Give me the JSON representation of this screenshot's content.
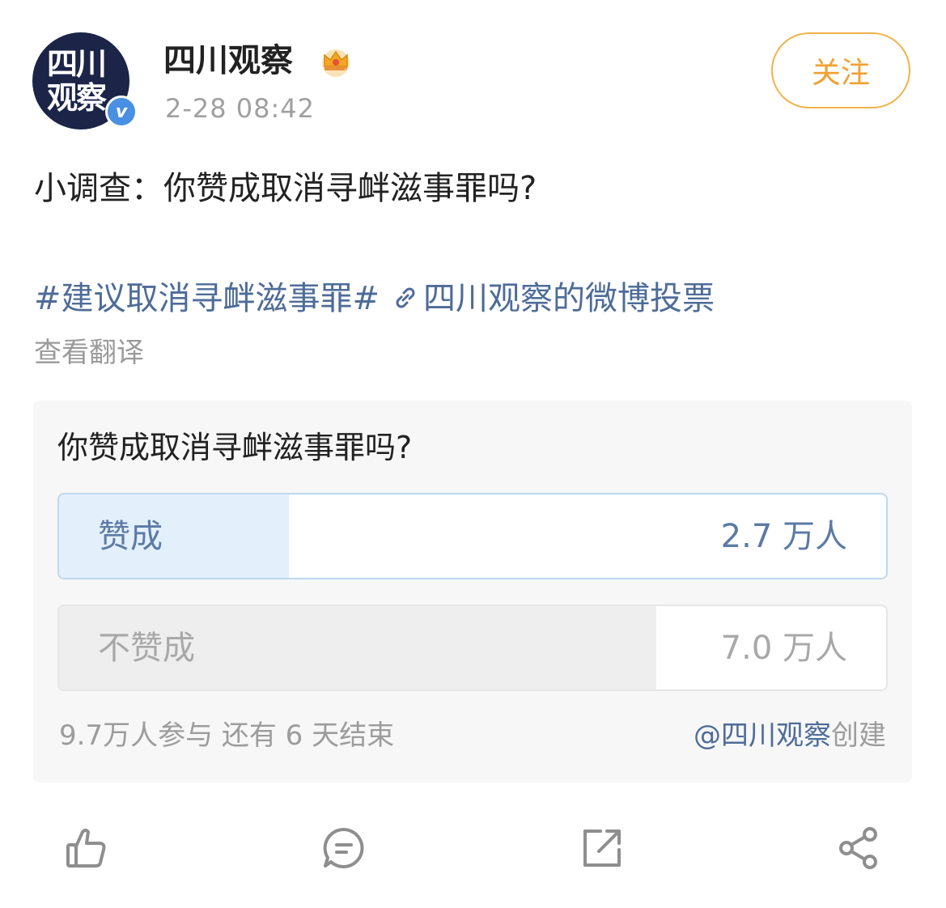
{
  "account": {
    "avatar_text": "四川\n观察",
    "verified_mark": "v",
    "name": "四川观察",
    "badge_icon": "crown-icon",
    "time": "2-28 08:42",
    "follow_label": "关注"
  },
  "post": {
    "text": "小调查：你赞成取消寻衅滋事罪吗?",
    "topic": "#建议取消寻衅滋事罪#",
    "link_icon": "link-icon",
    "link_text": "四川观察的微博投票",
    "translate_label": "查看翻译"
  },
  "poll": {
    "question": "你赞成取消寻衅滋事罪吗?",
    "options": [
      {
        "label": "赞成",
        "count": "2.7 万人",
        "share": 0.278
      },
      {
        "label": "不赞成",
        "count": "7.0 万人",
        "share": 0.722
      }
    ],
    "summary": "9.7万人参与 还有 6 天结束",
    "creator": "@四川观察",
    "created_label": "创建"
  },
  "actions": [
    {
      "icon": "thumbs-up-icon"
    },
    {
      "icon": "comment-icon"
    },
    {
      "icon": "repost-icon"
    },
    {
      "icon": "share-icon"
    }
  ],
  "colors": {
    "link": "#4e6c98",
    "follow": "#f0a030",
    "poll_yes_fill": "#e3f0fc",
    "poll_no_fill": "#eeeeee"
  }
}
